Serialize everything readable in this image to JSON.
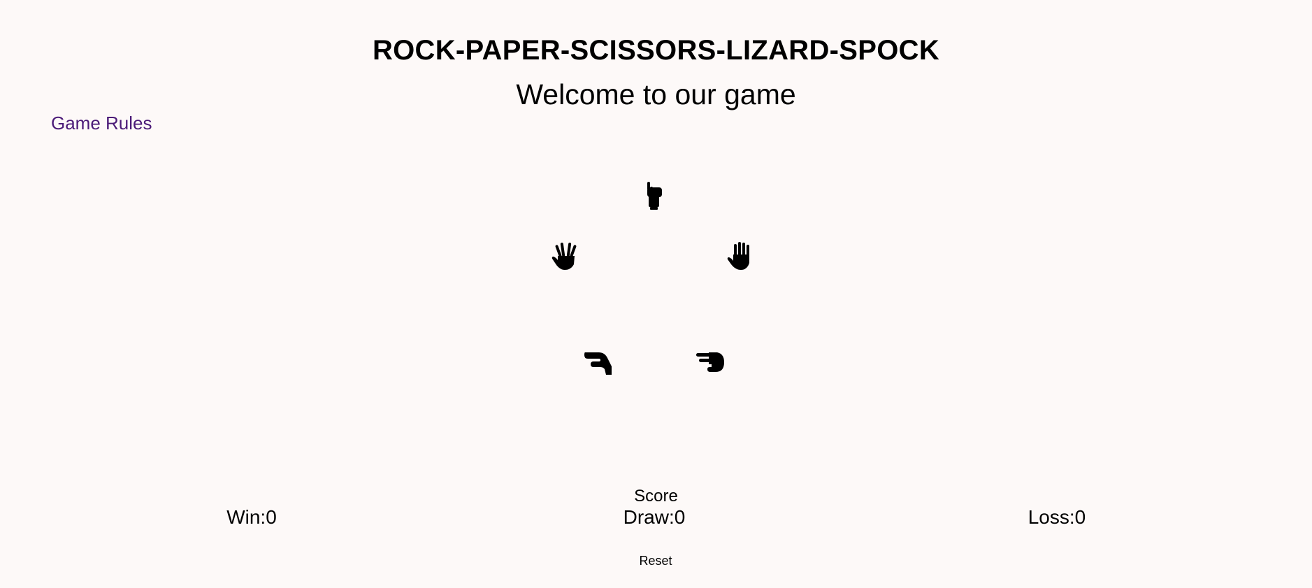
{
  "header": {
    "title": "ROCK-PAPER-SCISSORS-LIZARD-SPOCK",
    "subtitle": "Welcome to our game"
  },
  "nav": {
    "rules_link": "Game Rules",
    "link_color": "#4b1a78"
  },
  "choices": [
    {
      "id": "rock",
      "icon": "hand-rock-icon"
    },
    {
      "id": "spock",
      "icon": "hand-spock-icon"
    },
    {
      "id": "paper",
      "icon": "hand-paper-icon"
    },
    {
      "id": "lizard",
      "icon": "hand-lizard-icon"
    },
    {
      "id": "scissors",
      "icon": "hand-scissors-icon"
    }
  ],
  "score": {
    "label": "Score",
    "win_label": "Win:",
    "win": "0",
    "draw_label": "Draw:",
    "draw": "0",
    "loss_label": "Loss:",
    "loss": "0"
  },
  "controls": {
    "reset_label": "Reset"
  },
  "colors": {
    "background": "#fdf9f8",
    "text": "#000000"
  }
}
